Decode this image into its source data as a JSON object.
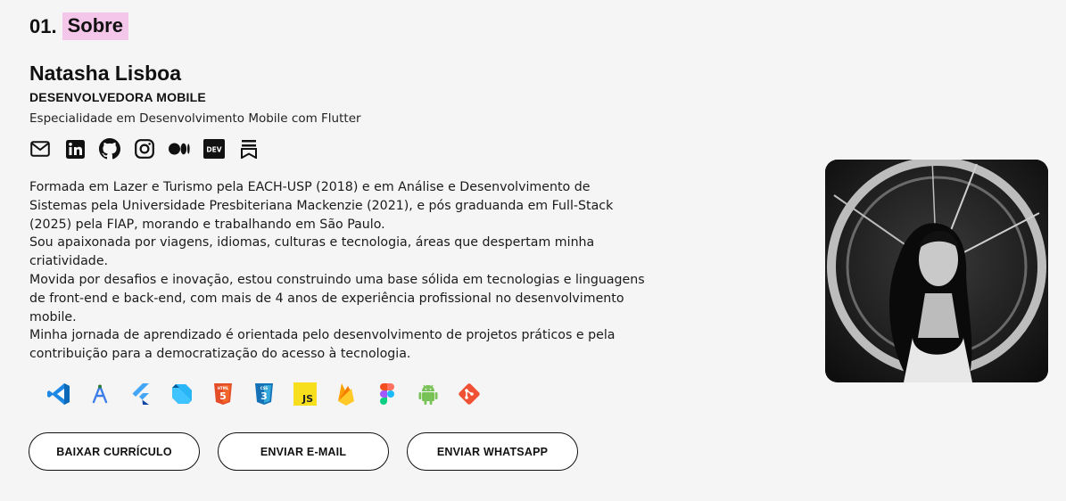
{
  "section": {
    "number": "01.",
    "title": "Sobre"
  },
  "profile": {
    "name": "Natasha Lisboa",
    "role": "DESENVOLVEDORA MOBILE",
    "specialty": "Especialidade em Desenvolvimento Mobile com Flutter"
  },
  "social": [
    {
      "icon": "mail-icon"
    },
    {
      "icon": "linkedin-icon"
    },
    {
      "icon": "github-icon"
    },
    {
      "icon": "instagram-icon"
    },
    {
      "icon": "medium-icon"
    },
    {
      "icon": "dev-icon",
      "label": "DEV"
    },
    {
      "icon": "bookmark-icon"
    }
  ],
  "bio": [
    "Formada em Lazer e Turismo pela EACH-USP (2018) e em Análise e Desenvolvimento de Sistemas pela Universidade Presbiteriana Mackenzie (2021), e pós graduanda em Full-Stack (2025) pela FIAP, morando e trabalhando em São Paulo.",
    "Sou apaixonada por viagens, idiomas, culturas e tecnologia, áreas que despertam minha criatividade.",
    "Movida por desafios e inovação, estou construindo uma base sólida em tecnologias e linguagens de front-end e back-end, com mais de 4 anos de experiência profissional no desenvolvimento mobile.",
    "Minha jornada de aprendizado é orientada pelo desenvolvimento de projetos práticos e pela contribuição para a democratização do acesso à tecnologia."
  ],
  "tech_icons": [
    {
      "icon": "vscode-icon"
    },
    {
      "icon": "android-studio-icon"
    },
    {
      "icon": "flutter-icon"
    },
    {
      "icon": "dart-icon"
    },
    {
      "icon": "html5-icon",
      "label": "HTML"
    },
    {
      "icon": "css3-icon",
      "label": "CSS"
    },
    {
      "icon": "javascript-icon",
      "label": "JS"
    },
    {
      "icon": "firebase-icon"
    },
    {
      "icon": "figma-icon"
    },
    {
      "icon": "android-icon"
    },
    {
      "icon": "git-icon"
    }
  ],
  "buttons": {
    "resume": "BAIXAR CURRÍCULO",
    "email": "ENVIAR E-MAIL",
    "whatsapp": "ENVIAR WHATSAPP"
  },
  "colors": {
    "background": "#f5f5f5",
    "highlight": "#f4c7ea",
    "text": "#111111"
  }
}
